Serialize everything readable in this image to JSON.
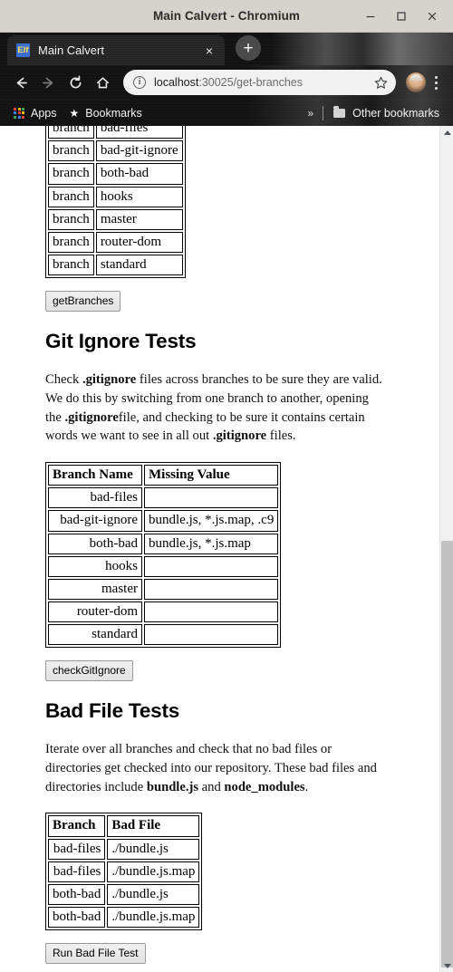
{
  "window": {
    "title": "Main Calvert - Chromium",
    "controls": {
      "minimize": "minimize-icon",
      "maximize": "maximize-icon",
      "close": "close-icon"
    }
  },
  "tabstrip": {
    "tab": {
      "favicon_text": "Elf",
      "title": "Main Calvert",
      "close": "×"
    },
    "new_tab": "+"
  },
  "toolbar": {
    "back": "←",
    "forward": "→",
    "reload": "⟳",
    "home": "⌂",
    "omnibox": {
      "info_glyph": "i",
      "url_host": "localhost",
      "url_rest": ":30025/get-branches",
      "star": "☆"
    },
    "menu": "⋮"
  },
  "bookmarks_bar": {
    "apps": "Apps",
    "bookmarks": "Bookmarks",
    "overflow": "»",
    "other_bookmarks": "Other bookmarks"
  },
  "page": {
    "branches_table": {
      "rows": [
        {
          "key": "branch",
          "value": "bad-files"
        },
        {
          "key": "branch",
          "value": "bad-git-ignore"
        },
        {
          "key": "branch",
          "value": "both-bad"
        },
        {
          "key": "branch",
          "value": "hooks"
        },
        {
          "key": "branch",
          "value": "master"
        },
        {
          "key": "branch",
          "value": "router-dom"
        },
        {
          "key": "branch",
          "value": "standard"
        }
      ]
    },
    "get_branches_button": "getBranches",
    "git_ignore": {
      "heading": "Git Ignore Tests",
      "paragraph_parts": [
        {
          "text": "Check ",
          "bold": false
        },
        {
          "text": ".gitignore",
          "bold": true
        },
        {
          "text": " files across branches to be sure they are valid. We do this by switching from one branch to another, opening the ",
          "bold": false
        },
        {
          "text": ".gitignore",
          "bold": true
        },
        {
          "text": "file, and checking to be sure it contains certain words we want to see in all out ",
          "bold": false
        },
        {
          "text": ".gitignore",
          "bold": true
        },
        {
          "text": " files.",
          "bold": false
        }
      ],
      "table": {
        "headers": [
          "Branch Name",
          "Missing Value"
        ],
        "rows": [
          {
            "branch": "bad-files",
            "missing": ""
          },
          {
            "branch": "bad-git-ignore",
            "missing": "bundle.js, *.js.map, .c9"
          },
          {
            "branch": "both-bad",
            "missing": "bundle.js, *.js.map"
          },
          {
            "branch": "hooks",
            "missing": ""
          },
          {
            "branch": "master",
            "missing": ""
          },
          {
            "branch": "router-dom",
            "missing": ""
          },
          {
            "branch": "standard",
            "missing": ""
          }
        ]
      },
      "button": "checkGitIgnore"
    },
    "bad_file": {
      "heading": "Bad File Tests",
      "paragraph_parts": [
        {
          "text": "Iterate over all branches and check that no bad files or directories get checked into our repository. These bad files and directories include ",
          "bold": false
        },
        {
          "text": "bundle.js",
          "bold": true
        },
        {
          "text": " and ",
          "bold": false
        },
        {
          "text": "node_modules",
          "bold": true
        },
        {
          "text": ".",
          "bold": false
        }
      ],
      "table": {
        "headers": [
          "Branch",
          "Bad File"
        ],
        "rows": [
          {
            "branch": "bad-files",
            "file": "./bundle.js"
          },
          {
            "branch": "bad-files",
            "file": "./bundle.js.map"
          },
          {
            "branch": "both-bad",
            "file": "./bundle.js"
          },
          {
            "branch": "both-bad",
            "file": "./bundle.js.map"
          }
        ]
      },
      "button": "Run Bad File Test"
    }
  },
  "scrollbar": {
    "up_arrow": "▲",
    "down_arrow": "▼",
    "thumb_top_pct": 47.5,
    "thumb_height_pct": 50.5
  },
  "colors": {
    "titlebar_bg": "#d6d2cc",
    "chrome_dark": "#111111",
    "favicon_bg": "#3b6fd4",
    "favicon_fg": "#ffe14d",
    "omnibox_bg": "#f1f1f1",
    "scrollbar_track": "#f1f1f1",
    "scrollbar_thumb": "#c1c1c1",
    "page_bg": "#ffffff",
    "text": "#000000"
  }
}
